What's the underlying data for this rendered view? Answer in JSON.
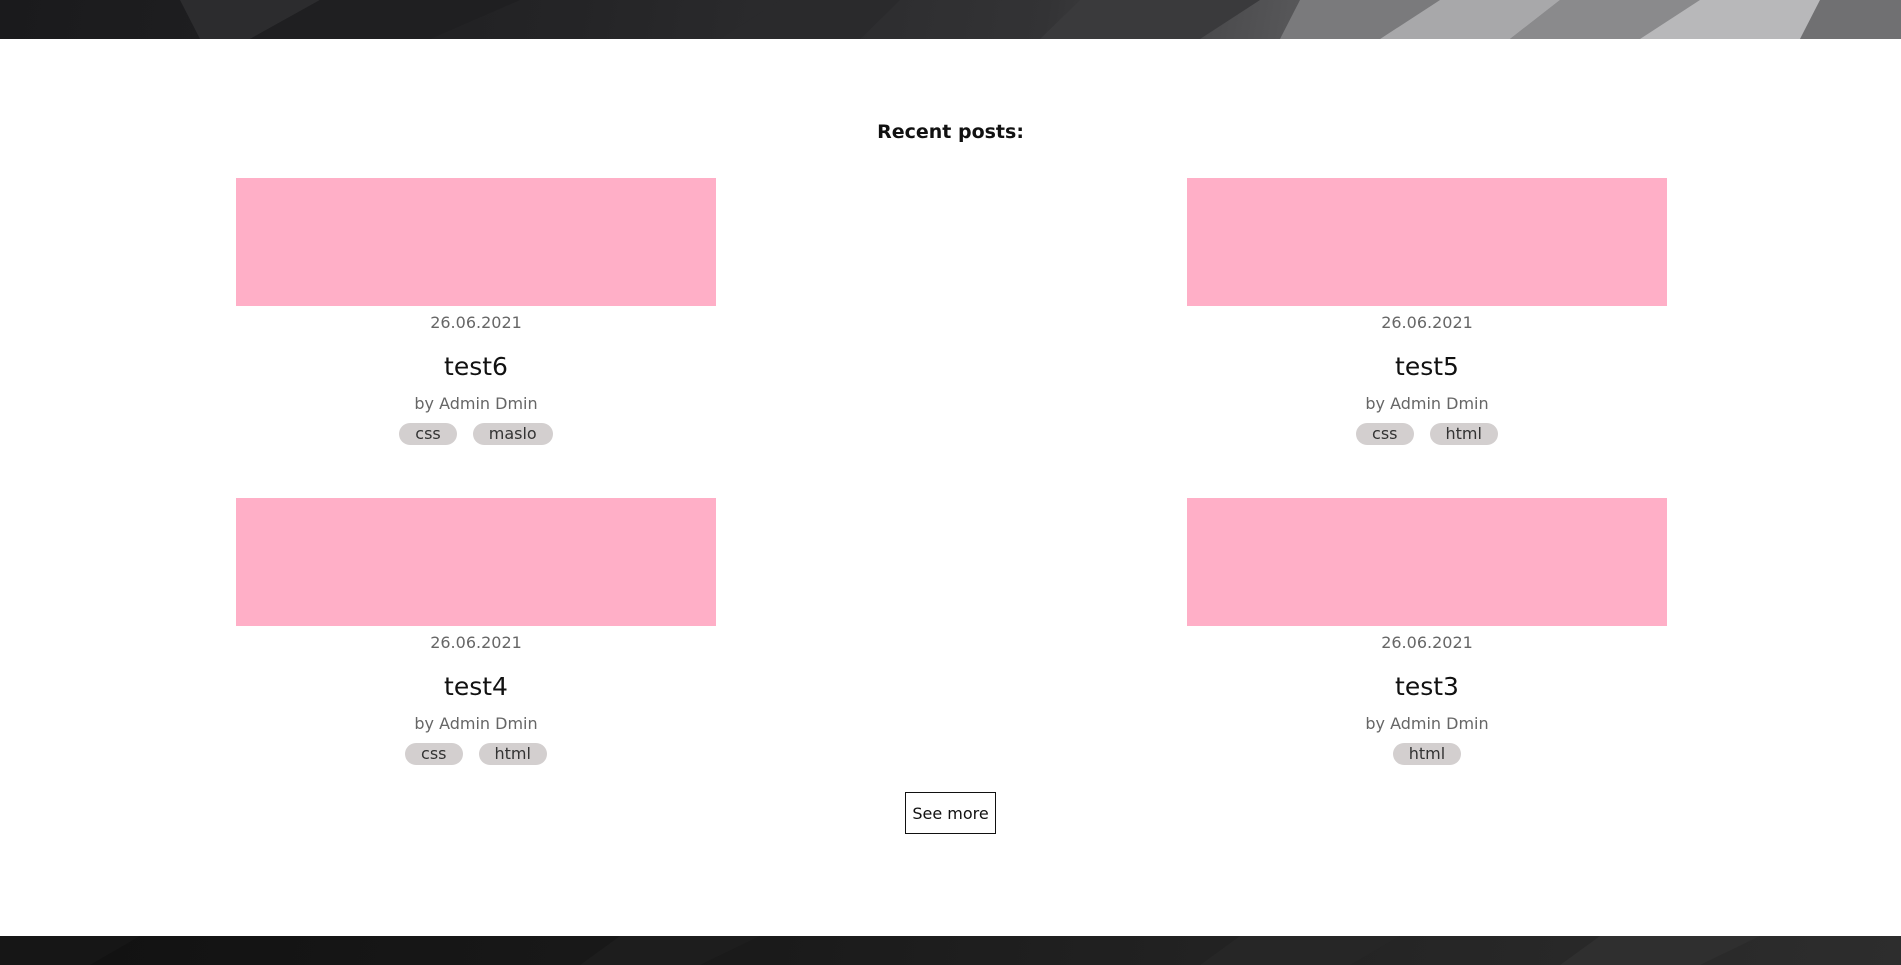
{
  "section": {
    "title": "Recent posts:"
  },
  "colors": {
    "thumbnail": "#ffafc7",
    "tag_bg": "#d3cfcf"
  },
  "posts": [
    {
      "date": "26.06.2021",
      "title": "test6",
      "author": "by Admin Dmin",
      "tags": [
        "css",
        "maslo"
      ]
    },
    {
      "date": "26.06.2021",
      "title": "test5",
      "author": "by Admin Dmin",
      "tags": [
        "css",
        "html"
      ]
    },
    {
      "date": "26.06.2021",
      "title": "test4",
      "author": "by Admin Dmin",
      "tags": [
        "css",
        "html"
      ]
    },
    {
      "date": "26.06.2021",
      "title": "test3",
      "author": "by Admin Dmin",
      "tags": [
        "html"
      ]
    }
  ],
  "see_more": {
    "label": "See more"
  }
}
